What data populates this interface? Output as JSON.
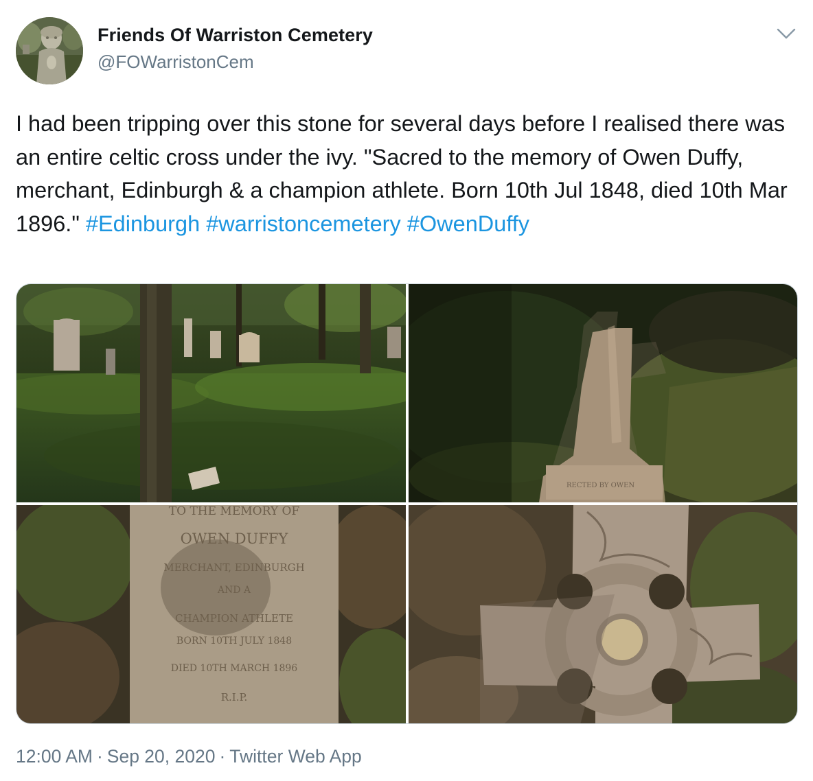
{
  "user": {
    "display_name": "Friends Of Warriston Cemetery",
    "handle": "@FOWarristonCem",
    "avatar_icon": "cherub-statue-avatar"
  },
  "tweet": {
    "text": "I had been tripping over this stone for several days before I realised there was an entire celtic cross under the ivy. \"Sacred to the memory of Owen Duffy, merchant, Edinburgh & a champion athlete. Born 10th Jul 1848, died 10th Mar 1896.\"",
    "hashtags": [
      "#Edinburgh",
      "#warristoncemetery",
      "#OwenDuffy"
    ]
  },
  "media": {
    "photos": [
      {
        "icon": "ivy-covered-graveyard-photo"
      },
      {
        "icon": "fallen-cross-in-ivy-photo"
      },
      {
        "icon": "inscribed-stone-closeup-photo"
      },
      {
        "icon": "celtic-cross-head-photo"
      }
    ],
    "inscription_lines": [
      "TO THE MEMORY OF",
      "OWEN DUFFY",
      "MERCHANT, EDINBURGH",
      "AND A",
      "CHAMPION ATHLETE",
      "BORN 10TH JULY 1848",
      "DIED 10TH MARCH 1896",
      "R.I.P."
    ]
  },
  "footer": {
    "time": "12:00 AM",
    "separator": "·",
    "date": "Sep 20, 2020",
    "source": "Twitter Web App"
  },
  "colors": {
    "text": "#14171a",
    "secondary": "#657786",
    "link": "#1b95e0",
    "border": "#ccd6dd"
  }
}
